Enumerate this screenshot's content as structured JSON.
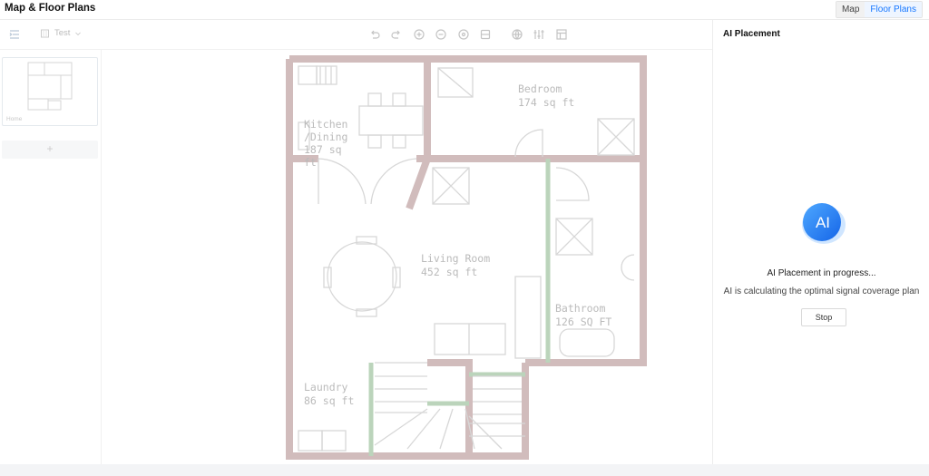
{
  "header": {
    "title": "Map & Floor Plans",
    "tabs": [
      {
        "label": "Map",
        "active": false
      },
      {
        "label": "Floor Plans",
        "active": true
      }
    ],
    "accent_color": "#1677ff"
  },
  "toolbar": {
    "layer_select_value": "Test",
    "icons": [
      "list-toggle-icon",
      "undo-icon",
      "redo-icon",
      "zoom-in-icon",
      "zoom-out-icon",
      "fit-view-icon",
      "export-icon",
      "globe-icon",
      "sliders-icon",
      "grid-icon"
    ]
  },
  "floor_list": {
    "items": [
      {
        "label": "Home"
      }
    ],
    "add_label": "+"
  },
  "floor_plan": {
    "rooms": [
      {
        "name_lines": [
          "Kitchen",
          "/Dining",
          "187 sq",
          "ft"
        ]
      },
      {
        "name_lines": [
          "Bedroom",
          "174 sq ft"
        ]
      },
      {
        "name_lines": [
          "Living Room",
          "452 sq ft"
        ]
      },
      {
        "name_lines": [
          "Bathroom",
          "126 SQ FT"
        ]
      },
      {
        "name_lines": [
          "Laundry",
          "86 sq ft"
        ]
      }
    ]
  },
  "panel": {
    "title": "AI Placement",
    "badge_text": "AI",
    "status": "AI Placement in progress...",
    "substatus": "AI is calculating the optimal signal coverage plan",
    "stop_label": "Stop"
  }
}
